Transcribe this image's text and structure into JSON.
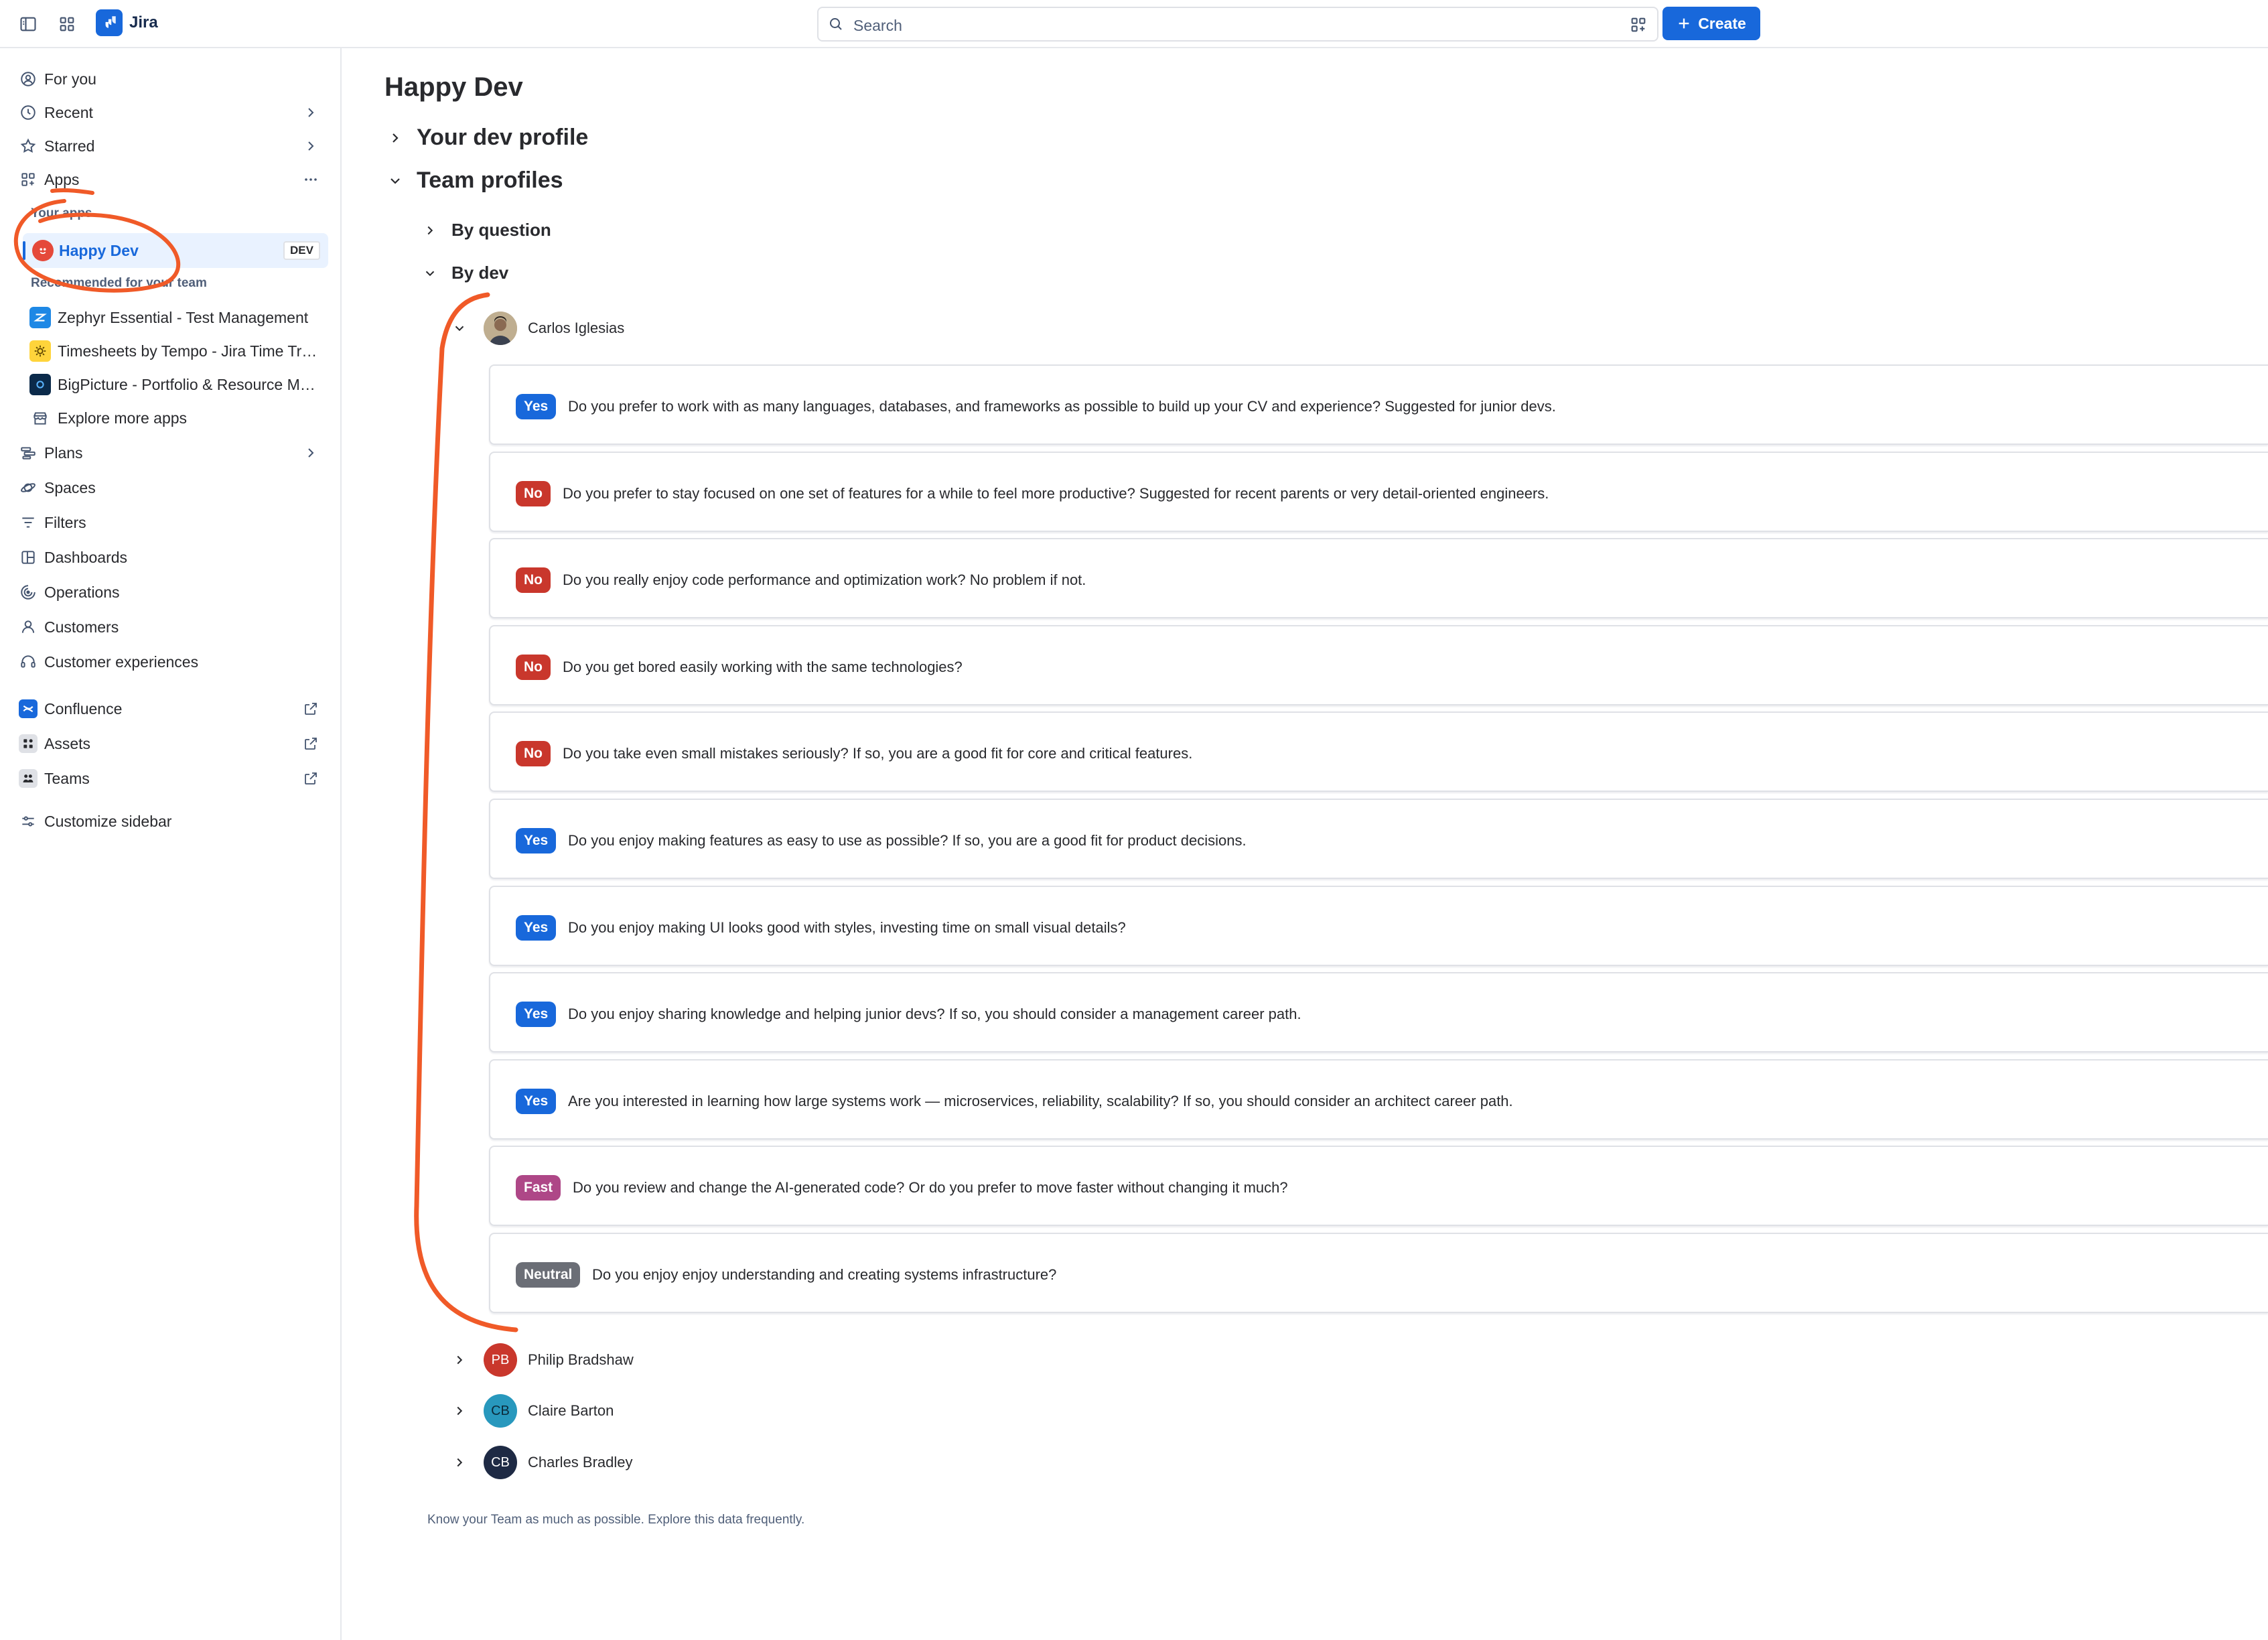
{
  "topbar": {
    "app_name": "Jira",
    "search_placeholder": "Search",
    "create_label": "Create",
    "brand_color": "#1868db"
  },
  "sidebar": {
    "top_items": [
      {
        "label": "For you",
        "icon": "person-circle-icon"
      },
      {
        "label": "Recent",
        "icon": "clock-icon"
      },
      {
        "label": "Starred",
        "icon": "star-icon"
      },
      {
        "label": "Apps",
        "icon": "apps-icon"
      }
    ],
    "your_apps_label": "Your apps",
    "active_app": {
      "label": "Happy Dev",
      "badge": "DEV"
    },
    "recommended_label": "Recommended for your team",
    "recommended_apps": [
      {
        "label": "Zephyr Essential - Test Management",
        "icon": "zephyr-icon"
      },
      {
        "label": "Timesheets by Tempo - Jira Time Tracking",
        "icon": "tempo-icon"
      },
      {
        "label": "BigPicture - Portfolio & Resource Management",
        "icon": "bigpicture-icon"
      },
      {
        "label": "Explore more apps",
        "icon": "store-icon"
      }
    ],
    "main_items": [
      {
        "label": "Plans",
        "icon": "plans-icon"
      },
      {
        "label": "Spaces",
        "icon": "spaces-icon"
      },
      {
        "label": "Filters",
        "icon": "filter-icon"
      },
      {
        "label": "Dashboards",
        "icon": "dashboard-icon"
      },
      {
        "label": "Operations",
        "icon": "operations-icon"
      },
      {
        "label": "Customers",
        "icon": "customer-icon"
      },
      {
        "label": "Customer experiences",
        "icon": "headset-icon"
      }
    ],
    "external_items": [
      {
        "label": "Confluence",
        "icon": "confluence-icon"
      },
      {
        "label": "Assets",
        "icon": "assets-icon"
      },
      {
        "label": "Teams",
        "icon": "teams-icon"
      }
    ],
    "customize_label": "Customize sidebar"
  },
  "main": {
    "title": "Happy Dev",
    "your_profile_label": "Your dev profile",
    "team_profiles_label": "Team profiles",
    "by_question_label": "By question",
    "by_dev_label": "By dev",
    "expanded_dev": {
      "name": "Carlos Iglesias",
      "answers": [
        {
          "answer": "Yes",
          "color": "#1868db",
          "question": "Do you prefer to work with as many languages, databases, and frameworks as possible to build up your CV and experience? Suggested for junior devs."
        },
        {
          "answer": "No",
          "color": "#c9372c",
          "question": "Do you prefer to stay focused on one set of features for a while to feel more productive? Suggested for recent parents or very detail-oriented engineers."
        },
        {
          "answer": "No",
          "color": "#c9372c",
          "question": "Do you really enjoy code performance and optimization work? No problem if not."
        },
        {
          "answer": "No",
          "color": "#c9372c",
          "question": "Do you get bored easily working with the same technologies?"
        },
        {
          "answer": "No",
          "color": "#c9372c",
          "question": "Do you take even small mistakes seriously? If so, you are a good fit for core and critical features."
        },
        {
          "answer": "Yes",
          "color": "#1868db",
          "question": "Do you enjoy making features as easy to use as possible? If so, you are a good fit for product decisions."
        },
        {
          "answer": "Yes",
          "color": "#1868db",
          "question": "Do you enjoy making UI looks good with styles, investing time on small visual details?"
        },
        {
          "answer": "Yes",
          "color": "#1868db",
          "question": "Do you enjoy sharing knowledge and helping junior devs? If so, you should consider a management career path."
        },
        {
          "answer": "Yes",
          "color": "#1868db",
          "question": "Are you interested in learning how large systems work — microservices, reliability, scalability? If so, you should consider an architect career path."
        },
        {
          "answer": "Fast",
          "color": "#ae4787",
          "question": "Do you review and change the AI-generated code? Or do you prefer to move faster without changing it much?"
        },
        {
          "answer": "Neutral",
          "color": "#6b6e76",
          "question": "Do you enjoy enjoy understanding and creating systems infrastructure?"
        }
      ]
    },
    "other_devs": [
      {
        "initials": "PB",
        "name": "Philip Bradshaw",
        "color": "#c9372c"
      },
      {
        "initials": "CB",
        "name": "Claire Barton",
        "color": "#2898bd"
      },
      {
        "initials": "CB",
        "name": "Charles Bradley",
        "color": "#1e2a44"
      }
    ],
    "footer_note": "Know your Team as much as possible. Explore this data frequently."
  }
}
